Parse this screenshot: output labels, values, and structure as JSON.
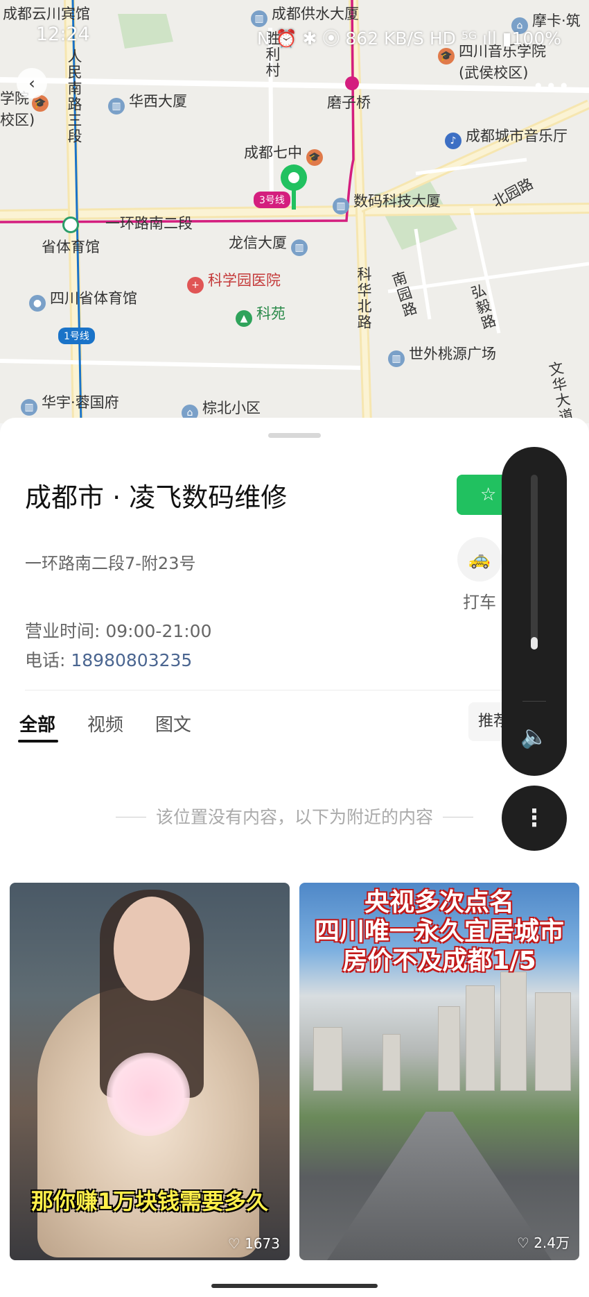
{
  "status_bar": {
    "time": "12:24",
    "icons_text": "N ⏰ ✱ ⦿ 862 KB/S HD ⁵ᴳ ıll ▮100%"
  },
  "map": {
    "labels": {
      "hotel": "成都云川宾馆",
      "water": "成都供水大厦",
      "moka": "摩卡·筑",
      "music_college": "四川音乐学院",
      "music_college_sub": "(武侯校区)",
      "left_school": "学院",
      "left_school_sub": "校区)",
      "renmin_road": "人民南路三段",
      "shengli": "胜利村",
      "huaxi": "华西大厦",
      "mozi": "磨子桥",
      "city_hall": "成都城市音乐厅",
      "chengdu7": "成都七中",
      "line3": "3号线",
      "digital": "数码科技大厦",
      "beiyuan": "北园路",
      "yihuan": "一环路南二段",
      "stadium": "省体育馆",
      "longxin": "龙信大厦",
      "kexue": "科学园医院",
      "kehua": "科华北路",
      "nanyuan": "南园路",
      "hongyi": "弘毅路",
      "sichuan_stadium": "四川省体育馆",
      "keyuan": "科苑",
      "line1": "1号线",
      "shiwai": "世外桃源广场",
      "wenhua": "文华大道",
      "huayu": "华宇·蓉国府",
      "zongbei": "棕北小区"
    }
  },
  "place": {
    "title": "成都市 · 凌飞数码维修",
    "address": "一环路南二段7-附23号",
    "hours_label": "营业时间: ",
    "hours_value": "09:00-21:00",
    "phone_label": "电话: ",
    "phone_value": "18980803235",
    "taxi_label": "打车",
    "favorite_icon": "star-icon"
  },
  "tabs": [
    {
      "label": "全部",
      "active": true
    },
    {
      "label": "视频",
      "active": false
    },
    {
      "label": "图文",
      "active": false
    }
  ],
  "sort_label": "推荐",
  "empty_tip": "该位置没有内容，以下为附近的内容",
  "cards": [
    {
      "caption": "那你赚1万块钱需要多久",
      "likes": "1673"
    },
    {
      "headline_1": "央视多次点名",
      "headline_2": "四川唯一永久宜居城市",
      "headline_3": "房价不及成都1/5",
      "likes": "2.4万"
    }
  ],
  "volume": {
    "level_fraction": 0.07,
    "icon": "speaker-icon",
    "more_icon": "more-vertical-icon"
  },
  "colors": {
    "accent_green": "#21c160",
    "metro_line3": "#d41e7e",
    "metro_line1": "#1a73c8"
  }
}
